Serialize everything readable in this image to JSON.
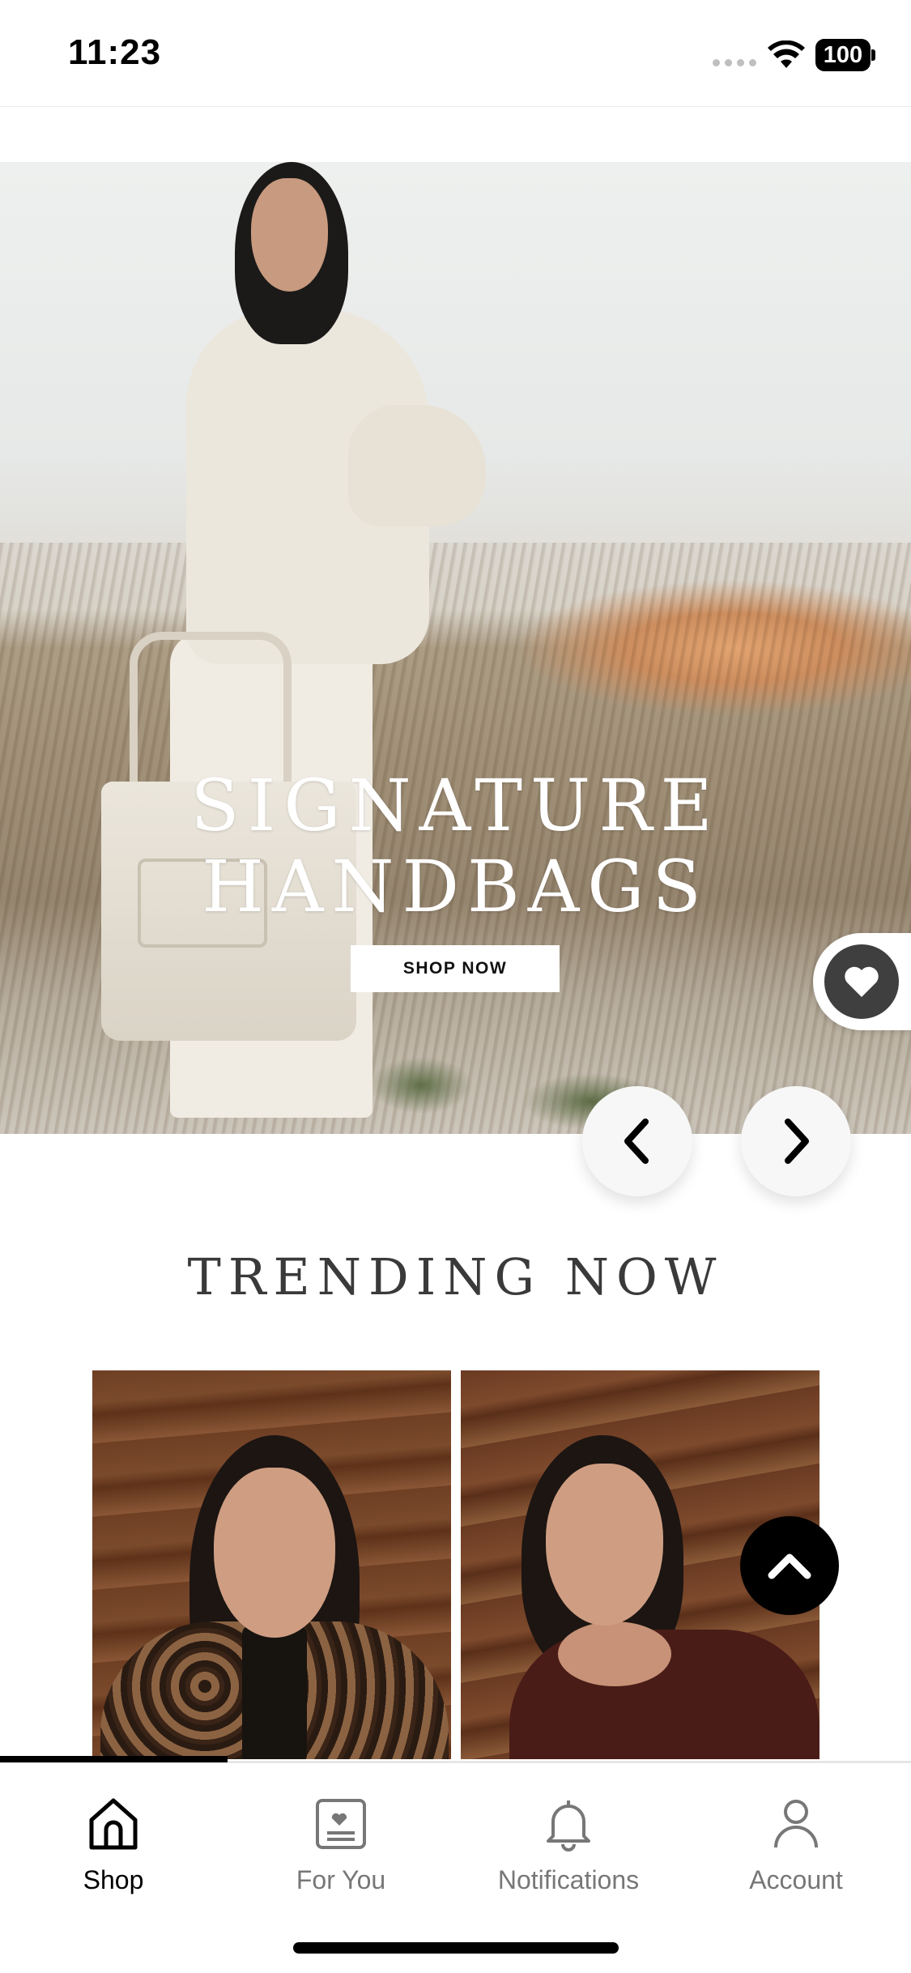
{
  "status_bar": {
    "time": "11:23",
    "battery": "100"
  },
  "hero": {
    "title_line1": "SIGNATURE",
    "title_line2": "HANDBAGS",
    "cta_label": "SHOP NOW"
  },
  "section": {
    "trending_title": "TRENDING NOW"
  },
  "scroll_progress": 0.25,
  "tabs": [
    {
      "label": "Shop",
      "icon": "home-icon",
      "active": true
    },
    {
      "label": "For You",
      "icon": "for-you-icon",
      "active": false
    },
    {
      "label": "Notifications",
      "icon": "bell-icon",
      "active": false
    },
    {
      "label": "Account",
      "icon": "user-icon",
      "active": false
    }
  ],
  "colors": {
    "accent": "#000000",
    "inactive_tab": "#777777",
    "wishlist_button": "#3f3f3f"
  }
}
